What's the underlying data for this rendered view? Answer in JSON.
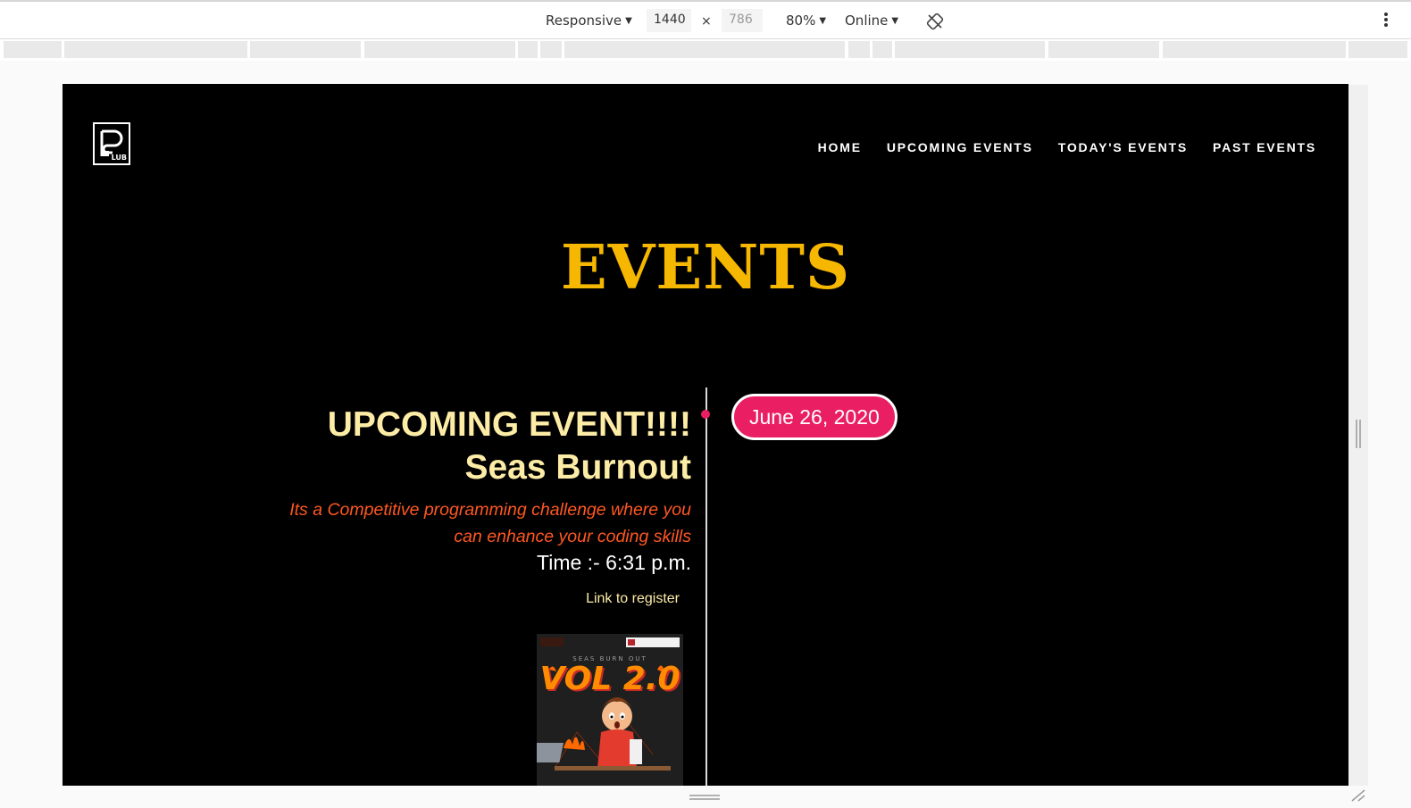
{
  "devtools": {
    "device": "Responsive",
    "width": "1440",
    "height": "786",
    "times": "×",
    "zoom": "80%",
    "network": "Online",
    "rotate_icon": "rotate-icon",
    "more_icon": "kebab-menu-icon"
  },
  "site": {
    "logo_text": "LUB",
    "nav": [
      "HOME",
      "UPCOMING EVENTS",
      "TODAY'S EVENTS",
      "PAST EVENTS"
    ],
    "page_title": "EVENTS"
  },
  "event": {
    "heading_line1": "UPCOMING EVENT!!!!",
    "heading_line2": "Seas Burnout",
    "description": "Its a Competitive programming challenge where you can enhance your coding skills",
    "time": "Time :- 6:31 p.m.",
    "link_text": "Link to register",
    "date": "June 26, 2020",
    "poster": {
      "subtitle": "SEAS BURN OUT",
      "title": "VOL 2.0"
    }
  },
  "colors": {
    "accent_gold": "#f5b700",
    "cream": "#fdeca6",
    "orange": "#ff5722",
    "pink": "#e91e63"
  }
}
